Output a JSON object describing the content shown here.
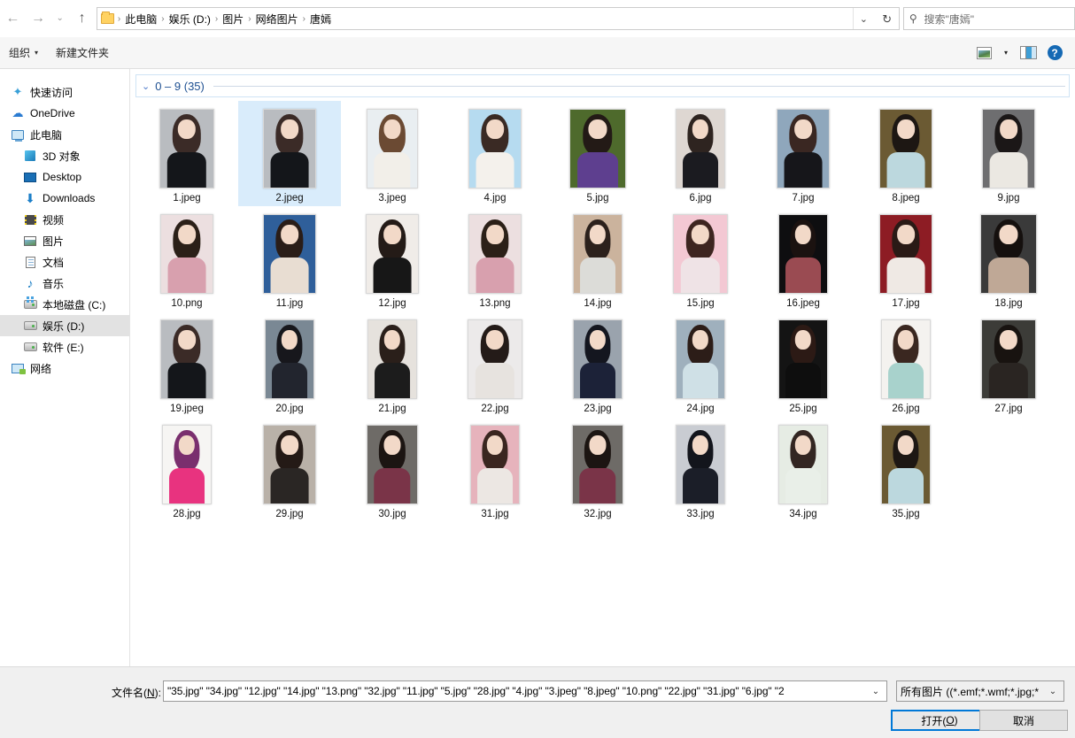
{
  "window": {
    "nav": {
      "back_label": "←",
      "forward_label": "→",
      "history_label": "⌄",
      "up_label": "↑"
    },
    "address": {
      "folder_icon": "folder-icon",
      "crumbs": [
        "此电脑",
        "娱乐 (D:)",
        "图片",
        "网络图片",
        "唐嫣"
      ],
      "separator": "›",
      "dropdown_label": "⌄",
      "refresh_label": "↻"
    },
    "search": {
      "icon": "search-icon",
      "placeholder": "搜索\"唐嫣\""
    }
  },
  "commandbar": {
    "organize_label": "组织",
    "organize_caret": "▾",
    "new_folder_label": "新建文件夹",
    "view_icon": "picture-view-icon",
    "view_caret": "▾",
    "preview_pane_icon": "preview-pane-icon",
    "help_icon": "help-icon",
    "help_glyph": "?"
  },
  "sidebar": {
    "items": [
      {
        "label": "快速访问",
        "icon": "star-icon",
        "indent": false,
        "selected": false
      },
      {
        "label": "OneDrive",
        "icon": "cloud-icon",
        "indent": false,
        "selected": false
      },
      {
        "label": "此电脑",
        "icon": "computer-icon",
        "indent": false,
        "selected": false
      },
      {
        "label": "3D 对象",
        "icon": "3d-objects-icon",
        "indent": true,
        "selected": false
      },
      {
        "label": "Desktop",
        "icon": "desktop-icon",
        "indent": true,
        "selected": false
      },
      {
        "label": "Downloads",
        "icon": "downloads-icon",
        "indent": true,
        "selected": false
      },
      {
        "label": "视频",
        "icon": "videos-icon",
        "indent": true,
        "selected": false
      },
      {
        "label": "图片",
        "icon": "pictures-icon",
        "indent": true,
        "selected": false
      },
      {
        "label": "文档",
        "icon": "documents-icon",
        "indent": true,
        "selected": false
      },
      {
        "label": "音乐",
        "icon": "music-icon",
        "indent": true,
        "selected": false
      },
      {
        "label": "本地磁盘 (C:)",
        "icon": "windows-drive-icon",
        "indent": true,
        "selected": false
      },
      {
        "label": "娱乐 (D:)",
        "icon": "drive-icon",
        "indent": true,
        "selected": true
      },
      {
        "label": "软件 (E:)",
        "icon": "drive-icon",
        "indent": true,
        "selected": false
      },
      {
        "label": "网络",
        "icon": "network-icon",
        "indent": false,
        "selected": false
      }
    ]
  },
  "filelist": {
    "group": {
      "chevron": "⌄",
      "title": "0 – 9 (35)"
    },
    "files": [
      {
        "name": "1.jpeg",
        "selected": false,
        "bg": "#b9bcc0",
        "hair": "#3b2b27",
        "body": "#14161a",
        "w": 62,
        "h": 90
      },
      {
        "name": "2.jpeg",
        "selected": true,
        "bg": "#b9bcc0",
        "hair": "#3b2b27",
        "body": "#14161a",
        "w": 60,
        "h": 90
      },
      {
        "name": "3.jpeg",
        "selected": false,
        "bg": "#e9eef1",
        "hair": "#6b4a33",
        "body": "#f2efe9",
        "w": 58,
        "h": 90
      },
      {
        "name": "4.jpg",
        "selected": false,
        "bg": "#b6dbf0",
        "hair": "#3a2a24",
        "body": "#f4f1ec",
        "w": 60,
        "h": 90
      },
      {
        "name": "5.jpg",
        "selected": false,
        "bg": "#4e6a2c",
        "hair": "#231a16",
        "body": "#5e3f8f",
        "w": 64,
        "h": 90
      },
      {
        "name": "6.jpg",
        "selected": false,
        "bg": "#ded7d2",
        "hair": "#2e2420",
        "body": "#1b1b20",
        "w": 56,
        "h": 90
      },
      {
        "name": "7.jpg",
        "selected": false,
        "bg": "#8fa7bc",
        "hair": "#3a2722",
        "body": "#16161a",
        "w": 60,
        "h": 90
      },
      {
        "name": "8.jpeg",
        "selected": false,
        "bg": "#6b5a33",
        "hair": "#1d1713",
        "body": "#bcd8de",
        "w": 60,
        "h": 90
      },
      {
        "name": "9.jpg",
        "selected": false,
        "bg": "#6e6e70",
        "hair": "#1b1717",
        "body": "#ebe8e2",
        "w": 60,
        "h": 90
      },
      {
        "name": "10.png",
        "selected": false,
        "bg": "#ecdfe0",
        "hair": "#2b2018",
        "body": "#d8a0ae",
        "w": 60,
        "h": 90
      },
      {
        "name": "11.jpg",
        "selected": false,
        "bg": "#2f5f9a",
        "hair": "#2a1d18",
        "body": "#e8ddd2",
        "w": 60,
        "h": 90
      },
      {
        "name": "12.jpg",
        "selected": false,
        "bg": "#f0ece8",
        "hair": "#241b17",
        "body": "#171717",
        "w": 60,
        "h": 90
      },
      {
        "name": "13.png",
        "selected": false,
        "bg": "#ecdfe0",
        "hair": "#2b2018",
        "body": "#d8a0ae",
        "w": 60,
        "h": 90
      },
      {
        "name": "14.jpg",
        "selected": false,
        "bg": "#cbb39d",
        "hair": "#2c211c",
        "body": "#dcdcd8",
        "w": 56,
        "h": 90
      },
      {
        "name": "15.jpg",
        "selected": false,
        "bg": "#f3c8d3",
        "hair": "#3d2520",
        "body": "#efe3e6",
        "w": 62,
        "h": 90
      },
      {
        "name": "16.jpeg",
        "selected": false,
        "bg": "#0e0e10",
        "hair": "#1b1210",
        "body": "#9a4b52",
        "w": 56,
        "h": 90
      },
      {
        "name": "17.jpg",
        "selected": false,
        "bg": "#8d1c24",
        "hair": "#2a1a16",
        "body": "#efe9e4",
        "w": 60,
        "h": 90
      },
      {
        "name": "18.jpg",
        "selected": false,
        "bg": "#3a3a3a",
        "hair": "#15100e",
        "body": "#bfa896",
        "w": 64,
        "h": 90
      },
      {
        "name": "19.jpeg",
        "selected": false,
        "bg": "#b9bcc0",
        "hair": "#3b2b27",
        "body": "#14161a",
        "w": 60,
        "h": 90
      },
      {
        "name": "20.jpg",
        "selected": false,
        "bg": "#7a8894",
        "hair": "#17171c",
        "body": "#22252e",
        "w": 56,
        "h": 90
      },
      {
        "name": "21.jpg",
        "selected": false,
        "bg": "#e6e2dd",
        "hair": "#2a1f1a",
        "body": "#1c1c1c",
        "w": 56,
        "h": 90
      },
      {
        "name": "22.jpg",
        "selected": false,
        "bg": "#eceaea",
        "hair": "#241b18",
        "body": "#e7e3df",
        "w": 62,
        "h": 90
      },
      {
        "name": "23.jpg",
        "selected": false,
        "bg": "#9aa3ad",
        "hair": "#14161f",
        "body": "#1c2238",
        "w": 56,
        "h": 90
      },
      {
        "name": "24.jpg",
        "selected": false,
        "bg": "#9fb0bd",
        "hair": "#2c1d18",
        "body": "#cfe0e6",
        "w": 56,
        "h": 90
      },
      {
        "name": "25.jpg",
        "selected": false,
        "bg": "#141414",
        "hair": "#2c1a15",
        "body": "#0e0e0e",
        "w": 56,
        "h": 90
      },
      {
        "name": "26.jpg",
        "selected": false,
        "bg": "#f4f2ef",
        "hair": "#3a2720",
        "body": "#a8d2cc",
        "w": 56,
        "h": 90
      },
      {
        "name": "27.jpg",
        "selected": false,
        "bg": "#3c3c38",
        "hair": "#181310",
        "body": "#2a2522",
        "w": 62,
        "h": 90
      },
      {
        "name": "28.jpg",
        "selected": false,
        "bg": "#f6f5f3",
        "hair": "#7a2f6e",
        "body": "#e8337f",
        "w": 56,
        "h": 90
      },
      {
        "name": "29.jpg",
        "selected": false,
        "bg": "#b9b1a8",
        "hair": "#241a16",
        "body": "#2a2624",
        "w": 60,
        "h": 90
      },
      {
        "name": "30.jpg",
        "selected": false,
        "bg": "#6e6b67",
        "hair": "#1c1512",
        "body": "#7a3448",
        "w": 58,
        "h": 90
      },
      {
        "name": "31.jpg",
        "selected": false,
        "bg": "#e6b3bc",
        "hair": "#3a2620",
        "body": "#ece7e3",
        "w": 56,
        "h": 90
      },
      {
        "name": "32.jpg",
        "selected": false,
        "bg": "#6e6b67",
        "hair": "#1c1512",
        "body": "#7a3448",
        "w": 58,
        "h": 90
      },
      {
        "name": "33.jpg",
        "selected": false,
        "bg": "#c9ccd2",
        "hair": "#13151c",
        "body": "#1b1e28",
        "w": 56,
        "h": 90
      },
      {
        "name": "34.jpg",
        "selected": false,
        "bg": "#e6ece4",
        "hair": "#332622",
        "body": "#e9efe8",
        "w": 56,
        "h": 90
      },
      {
        "name": "35.jpg",
        "selected": false,
        "bg": "#6b5a33",
        "hair": "#1d1713",
        "body": "#bcd8de",
        "w": 56,
        "h": 90
      }
    ]
  },
  "footer": {
    "filename_label": "文件名(N):",
    "filename_label_plain": "文件名(",
    "filename_accel": "N",
    "filename_label_tail": "):",
    "filename_value": "\"35.jpg\" \"34.jpg\" \"12.jpg\" \"14.jpg\" \"13.png\" \"32.jpg\" \"11.jpg\" \"5.jpg\" \"28.jpg\" \"4.jpg\" \"3.jpeg\" \"8.jpeg\" \"10.png\" \"22.jpg\" \"31.jpg\" \"6.jpg\" \"2",
    "filename_caret": "⌄",
    "filter_value": "所有图片 ((*.emf;*.wmf;*.jpg;*",
    "filter_caret": "⌄",
    "open_button": "打开(O)",
    "open_plain": "打开(",
    "open_accel": "O",
    "open_tail": ")",
    "cancel_button": "取消"
  },
  "colors": {
    "selection": "#d9ecfb",
    "accent": "#0078d7",
    "group_title": "#1d4f91",
    "chrome": "#f0f0f0"
  }
}
